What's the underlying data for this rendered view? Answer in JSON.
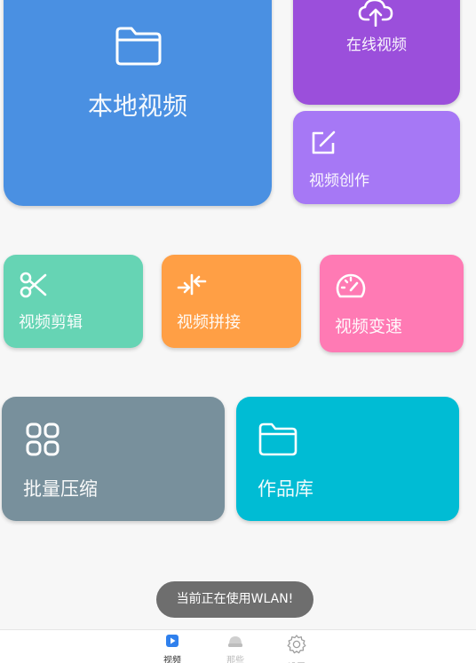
{
  "tiles": {
    "local_video": {
      "label": "本地视频",
      "icon": "folder-icon",
      "color": "#4a90e2"
    },
    "online_video": {
      "label": "在线视频",
      "icon": "cloud-upload-icon",
      "color": "#9b4fdb"
    },
    "video_create": {
      "label": "视频创作",
      "icon": "edit-icon",
      "color": "#a678f5"
    },
    "video_cut": {
      "label": "视频剪辑",
      "icon": "scissors-icon",
      "color": "#66d4b4"
    },
    "video_join": {
      "label": "视频拼接",
      "icon": "merge-arrows-icon",
      "color": "#ff9f45"
    },
    "video_speed": {
      "label": "视频变速",
      "icon": "speedometer-icon",
      "color": "#ff7ab4"
    },
    "batch_compress": {
      "label": "批量压缩",
      "icon": "grid-icon",
      "color": "#78909c"
    },
    "works_library": {
      "label": "作品库",
      "icon": "folder-icon",
      "color": "#00bcd4"
    }
  },
  "toast": {
    "text": "当前正在使用WLAN!"
  },
  "bottom_nav": {
    "items": [
      {
        "label": "视频",
        "icon": "play-icon",
        "active": true
      },
      {
        "label": "那些",
        "icon": "hat-icon",
        "active": false
      },
      {
        "label": "设置",
        "icon": "gear-icon",
        "active": false
      }
    ]
  }
}
